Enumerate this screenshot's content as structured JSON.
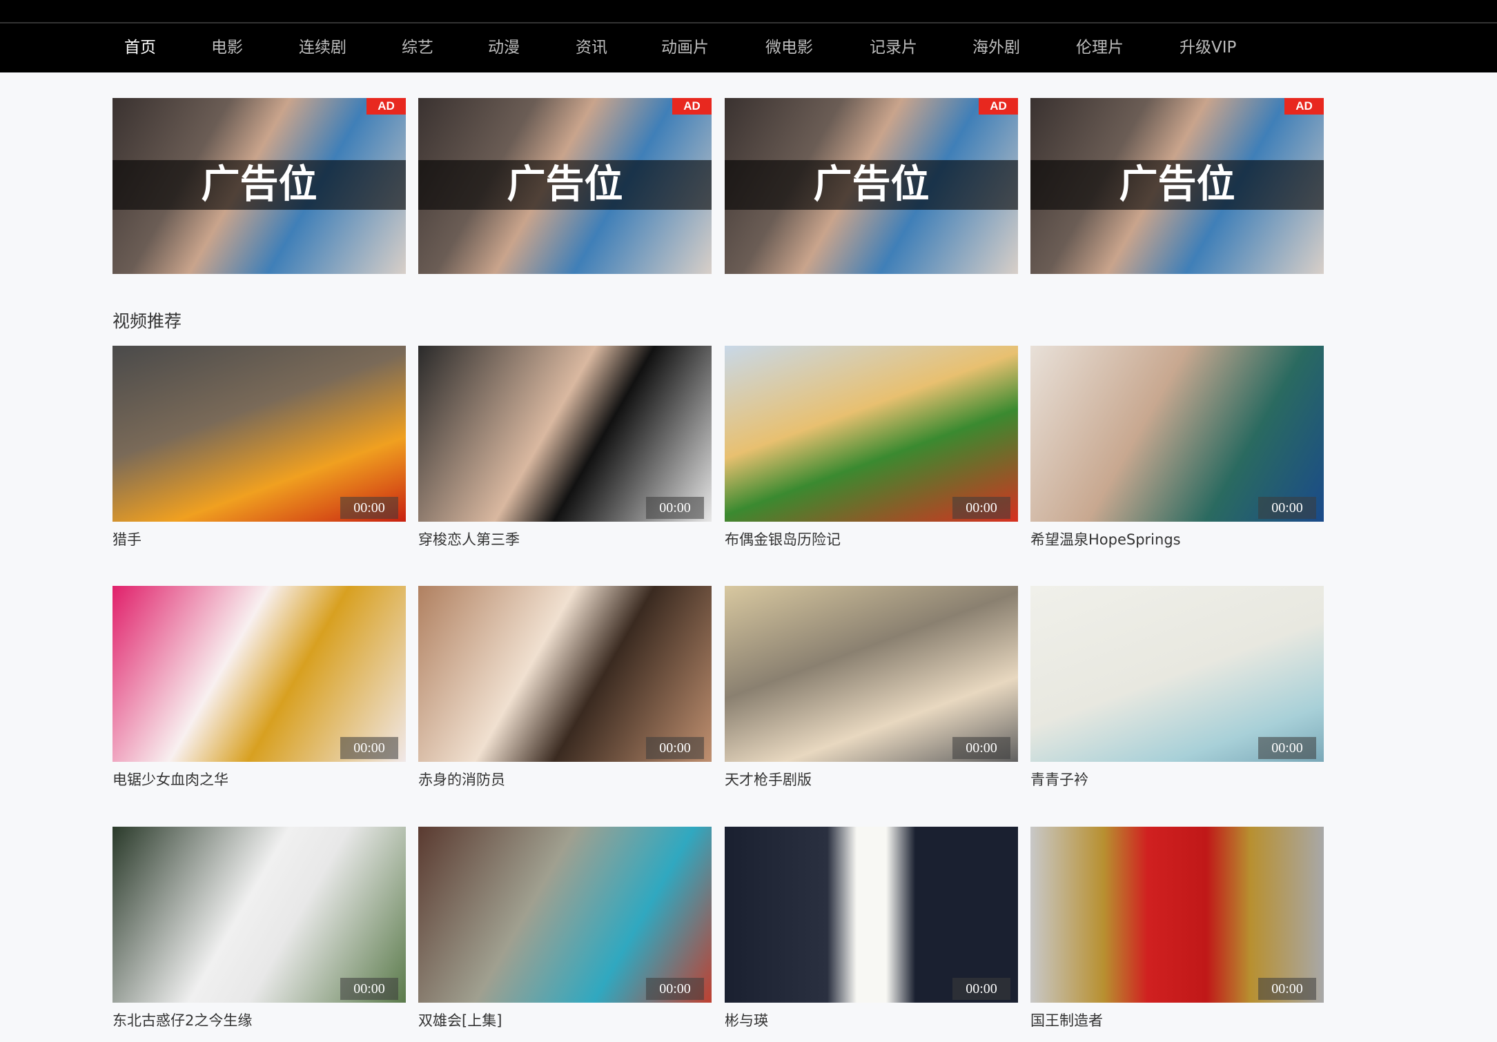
{
  "nav": {
    "items": [
      {
        "label": "首页",
        "active": true
      },
      {
        "label": "电影"
      },
      {
        "label": "连续剧"
      },
      {
        "label": "综艺"
      },
      {
        "label": "动漫"
      },
      {
        "label": "资讯"
      },
      {
        "label": "动画片"
      },
      {
        "label": "微电影"
      },
      {
        "label": "记录片"
      },
      {
        "label": "海外剧"
      },
      {
        "label": "伦理片"
      },
      {
        "label": "升级VIP"
      }
    ]
  },
  "ads": [
    {
      "badge": "AD",
      "text": "广告位"
    },
    {
      "badge": "AD",
      "text": "广告位"
    },
    {
      "badge": "AD",
      "text": "广告位"
    },
    {
      "badge": "AD",
      "text": "广告位"
    }
  ],
  "section": {
    "title": "视频推荐"
  },
  "videos": [
    {
      "title": "猎手",
      "duration": "00:00"
    },
    {
      "title": "穿梭恋人第三季",
      "duration": "00:00"
    },
    {
      "title": "布偶金银岛历险记",
      "duration": "00:00"
    },
    {
      "title": "希望温泉HopeSprings",
      "duration": "00:00"
    },
    {
      "title": "电锯少女血肉之华",
      "duration": "00:00"
    },
    {
      "title": "赤身的消防员",
      "duration": "00:00"
    },
    {
      "title": "天才枪手剧版",
      "duration": "00:00"
    },
    {
      "title": "青青子衿",
      "duration": "00:00"
    },
    {
      "title": "东北古惑仔2之今生缘",
      "duration": "00:00"
    },
    {
      "title": "双雄会[上集]",
      "duration": "00:00"
    },
    {
      "title": "彬与瑛",
      "duration": "00:00"
    },
    {
      "title": "国王制造者",
      "duration": "00:00"
    }
  ],
  "colors": {
    "ad_badge": "#e8281f",
    "nav_bg": "#000000",
    "page_bg": "#f7f8fa"
  }
}
